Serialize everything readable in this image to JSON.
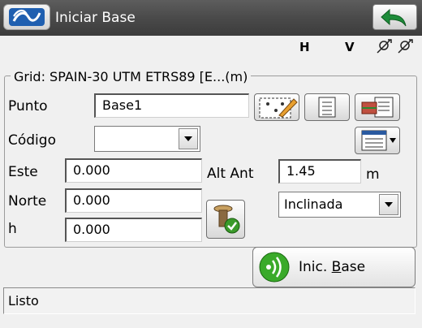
{
  "window": {
    "title": "Iniciar Base"
  },
  "indicators": {
    "h": "H",
    "v": "V"
  },
  "group": {
    "legend": "Grid: SPAIN-30 UTM ETRS89 [E...(m)"
  },
  "form": {
    "punto_label": "Punto",
    "punto_value": "Base1",
    "codigo_label": "Código",
    "codigo_value": "",
    "este_label": "Este",
    "este_value": "0.000",
    "norte_label": "Norte",
    "norte_value": "0.000",
    "h_label": "h",
    "h_value": "0.000",
    "alt_ant_label": "Alt Ant",
    "alt_ant_value": "1.45",
    "alt_ant_unit": "m",
    "medida_value": "Inclinada"
  },
  "actions": {
    "start_base_label": "Inic. Base",
    "start_base_mnemonic": "B"
  },
  "status": {
    "text": "Listo"
  },
  "icons": {
    "app_logo": "app-logo-icon",
    "back": "back-arrow-icon",
    "satellite": "satellite-icon",
    "map_pick": "map-pick-icon",
    "list": "list-icon",
    "point_list": "point-list-icon",
    "code_list": "code-list-icon",
    "antenna": "antenna-check-icon",
    "radio": "radio-wave-icon"
  },
  "colors": {
    "titlebar": "#4a4a4a",
    "accent_green": "#3a9a2a",
    "back_arrow": "#1e8c3a"
  }
}
